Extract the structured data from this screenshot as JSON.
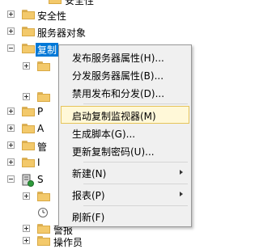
{
  "tree": {
    "partial_top_label": "安全性",
    "items": [
      {
        "label": "安全性",
        "expanded": false
      },
      {
        "label": "服务器对象",
        "expanded": false
      },
      {
        "label": "复制",
        "expanded": true,
        "selected": true
      },
      {
        "label": "",
        "expanded": false
      },
      {
        "label": "P",
        "expanded": false
      },
      {
        "label": "A",
        "expanded": false
      },
      {
        "label": "管",
        "expanded": false
      },
      {
        "label": "I",
        "expanded": false
      },
      {
        "label": "S",
        "expanded": true
      },
      {
        "label": "",
        "expanded": false
      },
      {
        "label": "",
        "expanded": false
      },
      {
        "label": "警报",
        "expanded": false
      },
      {
        "label": "操作员",
        "expanded": false
      }
    ]
  },
  "context_menu": {
    "items": [
      {
        "label": "发布服务器属性(H)..."
      },
      {
        "label": "分发服务器属性(B)..."
      },
      {
        "label": "禁用发布和分发(D)..."
      },
      {
        "label": "启动复制监视器(M)",
        "highlighted": true
      },
      {
        "label": "生成脚本(G)..."
      },
      {
        "label": "更新复制密码(U)..."
      },
      {
        "label": "新建(N)",
        "submenu": true
      },
      {
        "label": "报表(P)",
        "submenu": true
      },
      {
        "label": "刷新(F)"
      }
    ]
  }
}
